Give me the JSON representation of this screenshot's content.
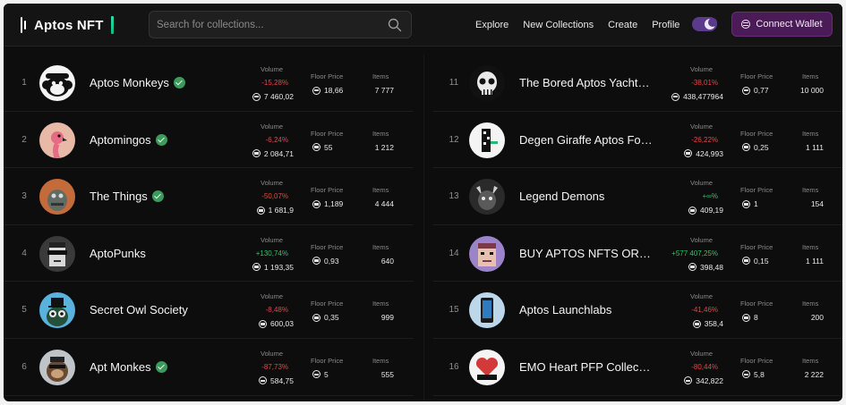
{
  "header": {
    "logo_text": "Aptos NFT",
    "search_placeholder": "Search for collections...",
    "nav": [
      "Explore",
      "New Collections",
      "Create",
      "Profile"
    ],
    "connect_label": "Connect Wallet"
  },
  "stat_labels": {
    "volume": "Volume",
    "floor": "Floor Price",
    "items": "Items"
  },
  "collections": [
    {
      "rank": "1",
      "name": "Aptos Monkeys",
      "verified": true,
      "change": "-15,28%",
      "change_dir": "neg",
      "volume": "7 460,02",
      "floor": "18,66",
      "items": "7 777",
      "avatar": "monkey-avatar"
    },
    {
      "rank": "2",
      "name": "Aptomingos",
      "verified": true,
      "change": "-6,24%",
      "change_dir": "neg",
      "volume": "2 084,71",
      "floor": "55",
      "items": "1 212",
      "avatar": "flamingo-avatar"
    },
    {
      "rank": "3",
      "name": "The Things",
      "verified": true,
      "change": "-50,07%",
      "change_dir": "neg",
      "volume": "1 681,9",
      "floor": "1,189",
      "items": "4 444",
      "avatar": "creature-avatar"
    },
    {
      "rank": "4",
      "name": "AptoPunks",
      "verified": false,
      "change": "+130,74%",
      "change_dir": "pos",
      "volume": "1 193,35",
      "floor": "0,93",
      "items": "640",
      "avatar": "punk-avatar"
    },
    {
      "rank": "5",
      "name": "Secret Owl Society",
      "verified": false,
      "change": "-8,48%",
      "change_dir": "neg",
      "volume": "600,03",
      "floor": "0,35",
      "items": "999",
      "avatar": "owl-avatar"
    },
    {
      "rank": "6",
      "name": "Apt Monkes",
      "verified": true,
      "change": "-87,73%",
      "change_dir": "neg",
      "volume": "584,75",
      "floor": "5",
      "items": "555",
      "avatar": "monke-avatar"
    },
    {
      "rank": "11",
      "name": "The Bored Aptos Yacht…",
      "verified": false,
      "change": "-38,01%",
      "change_dir": "neg",
      "volume": "438,477964",
      "floor": "0,77",
      "items": "10 000",
      "avatar": "skull-avatar"
    },
    {
      "rank": "12",
      "name": "Degen Giraffe Aptos Fo…",
      "verified": false,
      "change": "-26,22%",
      "change_dir": "neg",
      "volume": "424,993",
      "floor": "0,25",
      "items": "1 111",
      "avatar": "giraffe-avatar"
    },
    {
      "rank": "13",
      "name": "Legend Demons",
      "verified": false,
      "change": "+∞%",
      "change_dir": "pos",
      "volume": "409,19",
      "floor": "1",
      "items": "154",
      "avatar": "demon-avatar"
    },
    {
      "rank": "14",
      "name": "BUY APTOS NFTS OR I…",
      "verified": false,
      "change": "+577 407,25%",
      "change_dir": "pos",
      "volume": "398,48",
      "floor": "0,15",
      "items": "1 111",
      "avatar": "pixel-avatar"
    },
    {
      "rank": "15",
      "name": "Aptos Launchlabs",
      "verified": false,
      "change": "-41,46%",
      "change_dir": "neg",
      "volume": "358,4",
      "floor": "8",
      "items": "200",
      "avatar": "phone-avatar"
    },
    {
      "rank": "16",
      "name": "EMO Heart PFP Collect…",
      "verified": false,
      "change": "-80,44%",
      "change_dir": "neg",
      "volume": "342,822",
      "floor": "5,8",
      "items": "2 222",
      "avatar": "emo-heart-avatar"
    }
  ],
  "colors": {
    "accent": "#4a1b57",
    "positive": "#33c06a",
    "negative": "#e0464a",
    "verified": "#3c9a5c"
  }
}
